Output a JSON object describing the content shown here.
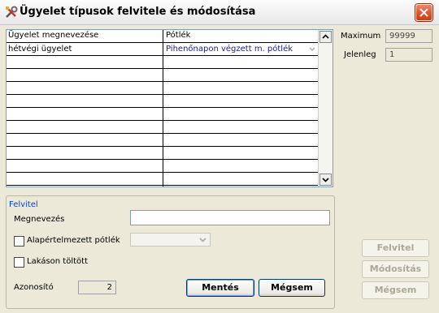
{
  "window": {
    "title": "Ügyelet típusok felvitele és módosítása",
    "icon": "tools-icon",
    "close": "close-icon"
  },
  "grid": {
    "columns": [
      "Ügyelet megnevezése",
      "Pótlék"
    ],
    "rows": [
      {
        "name": "hétvégi ügyelet",
        "potlek": "Pihenőnapon végzett m. pótlék"
      },
      {
        "name": "",
        "potlek": ""
      },
      {
        "name": "",
        "potlek": ""
      },
      {
        "name": "",
        "potlek": ""
      },
      {
        "name": "",
        "potlek": ""
      },
      {
        "name": "",
        "potlek": ""
      },
      {
        "name": "",
        "potlek": ""
      },
      {
        "name": "",
        "potlek": ""
      },
      {
        "name": "",
        "potlek": ""
      },
      {
        "name": "",
        "potlek": ""
      },
      {
        "name": "",
        "potlek": ""
      }
    ]
  },
  "stats": {
    "maximum_label": "Maximum",
    "maximum_value": "99999",
    "jelenleg_label": "Jelenleg",
    "jelenleg_value": "1"
  },
  "form": {
    "group_title": "Felvitel",
    "megnevezes_label": "Megnevezés",
    "megnevezes_value": "",
    "alapertelmezett_label": "Alapértelmezett pótlék",
    "alapertelmezett_checked": false,
    "alapertelmezett_value": "",
    "lakason_label": "Lakáson töltött",
    "lakason_checked": false,
    "azonosito_label": "Azonosító",
    "azonosito_value": "2",
    "save_label": "Mentés",
    "cancel_label": "Mégsem"
  },
  "side_buttons": {
    "felvitel": "Felvitel",
    "modositas": "Módosítás",
    "megsem": "Mégsem"
  }
}
